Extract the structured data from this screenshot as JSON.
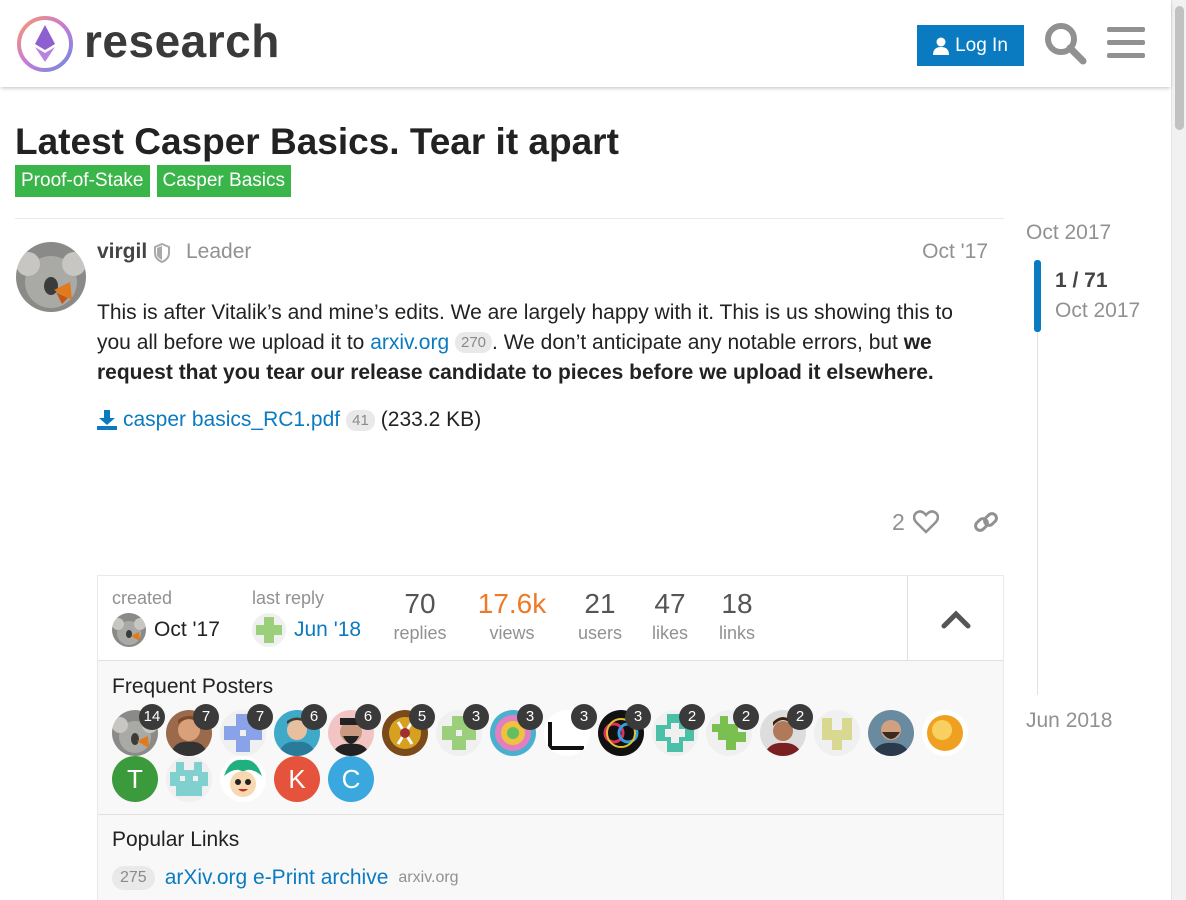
{
  "header": {
    "logo_text": "research",
    "login_label": "Log In"
  },
  "topic": {
    "title": "Latest Casper Basics. Tear it apart",
    "tags": [
      "Proof-of-Stake",
      "Casper Basics"
    ],
    "tag_color": "#3ab54a"
  },
  "post": {
    "username": "virgil",
    "user_title": "Leader",
    "date": "Oct '17",
    "body_part1": "This is after Vitalik’s and mine’s edits. We are largely happy with it. This is us showing this to you all before we upload it to ",
    "link_text": "arxiv.org",
    "link_clicks": "270",
    "body_part2": ". We don’t anticipate any notable errors, but ",
    "body_bold": "we request that you tear our release candidate to pieces before we upload it elsewhere.",
    "attachment_name": "casper basics_RC1.pdf",
    "attachment_clicks": "41",
    "attachment_size": "(233.2 KB)",
    "like_count": "2"
  },
  "topic_map": {
    "created_label": "created",
    "created_date": "Oct '17",
    "last_reply_label": "last reply",
    "last_reply_date": "Jun '18",
    "stats": [
      {
        "num": "70",
        "label": "replies"
      },
      {
        "num": "17.6k",
        "label": "views"
      },
      {
        "num": "21",
        "label": "users"
      },
      {
        "num": "47",
        "label": "likes"
      },
      {
        "num": "18",
        "label": "links"
      }
    ],
    "frequent_posters_title": "Frequent Posters",
    "poster_counts": [
      "14",
      "7",
      "7",
      "6",
      "6",
      "5",
      "3",
      "3",
      "3",
      "3",
      "2",
      "2",
      "2"
    ],
    "letter_avatars": [
      "T",
      "K",
      "C"
    ],
    "popular_links_title": "Popular Links",
    "popular_link_count": "275",
    "popular_link_text": "arXiv.org e-Print archive",
    "popular_link_domain": "arxiv.org"
  },
  "timeline": {
    "start": "Oct 2017",
    "position": "1 / 71",
    "position_date": "Oct 2017",
    "end": "Jun 2018"
  },
  "colors": {
    "accent": "#0a7bc1",
    "hot_views": "#ee7a27"
  }
}
